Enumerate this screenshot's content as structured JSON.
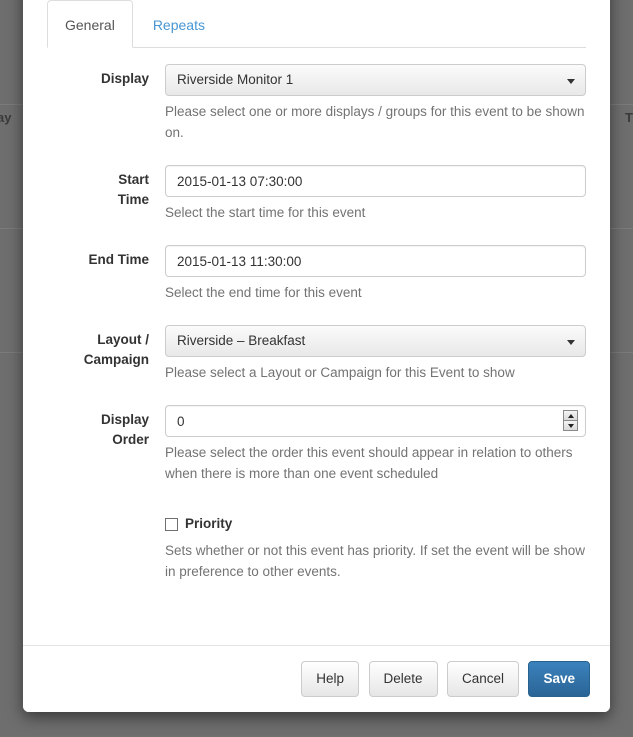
{
  "backdrop": {
    "left_text": "ay",
    "right_text": "T"
  },
  "modal": {
    "tabs": [
      {
        "label": "General",
        "active": true
      },
      {
        "label": "Repeats",
        "active": false
      }
    ],
    "fields": {
      "display": {
        "label": "Display",
        "value": "Riverside Monitor 1",
        "help": "Please select one or more displays / groups for this event to be shown on."
      },
      "start_time": {
        "label": "Start Time",
        "value": "2015-01-13 07:30:00",
        "help": "Select the start time for this event"
      },
      "end_time": {
        "label": "End Time",
        "value": "2015-01-13 11:30:00",
        "help": "Select the end time for this event"
      },
      "layout_campaign": {
        "label": "Layout / Campaign",
        "value": "Riverside – Breakfast",
        "help": "Please select a Layout or Campaign for this Event to show"
      },
      "display_order": {
        "label": "Display Order",
        "value": "0",
        "help": "Please select the order this event should appear in relation to others when there is more than one event scheduled"
      },
      "priority": {
        "label": "Priority",
        "checked": false,
        "help": "Sets whether or not this event has priority. If set the event will be show in preference to other events."
      }
    },
    "footer": {
      "help_label": "Help",
      "delete_label": "Delete",
      "cancel_label": "Cancel",
      "save_label": "Save"
    }
  },
  "colors": {
    "primary": "#2a6496",
    "link": "#4996d2",
    "text": "#333333",
    "muted": "#737373"
  }
}
